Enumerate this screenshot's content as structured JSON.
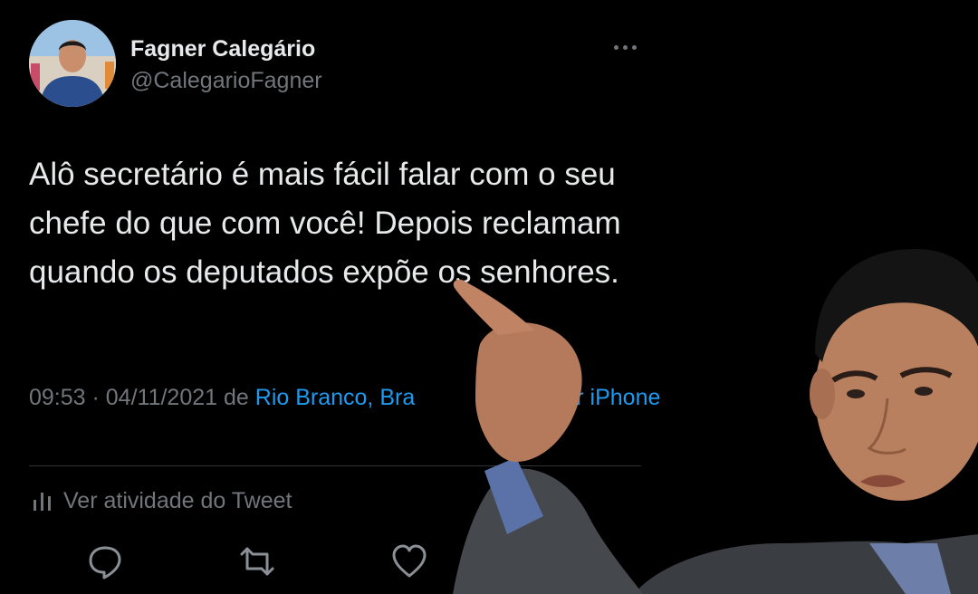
{
  "user": {
    "display_name": "Fagner Calegário",
    "handle": "@CalegarioFagner"
  },
  "tweet": {
    "text": "Alô secretário é mais fácil falar com o seu chefe do que com você! Depois reclamam quando os deputados expõe os senhores."
  },
  "meta": {
    "time": "09:53",
    "separator": " · ",
    "date": "04/11/2021",
    "from_word": " de ",
    "location": "Rio Branco, Bra",
    "source_visible": "er for iPhone"
  },
  "activity": {
    "label": "Ver atividade do Tweet"
  },
  "icons": {
    "more": "more-horizontal-icon",
    "activity": "bar-chart-icon",
    "reply": "reply-icon",
    "retweet": "retweet-icon",
    "like": "heart-icon"
  },
  "colors": {
    "background": "#000000",
    "text": "#e7e9ea",
    "secondary": "#71767b",
    "link": "#1d9bf0"
  }
}
